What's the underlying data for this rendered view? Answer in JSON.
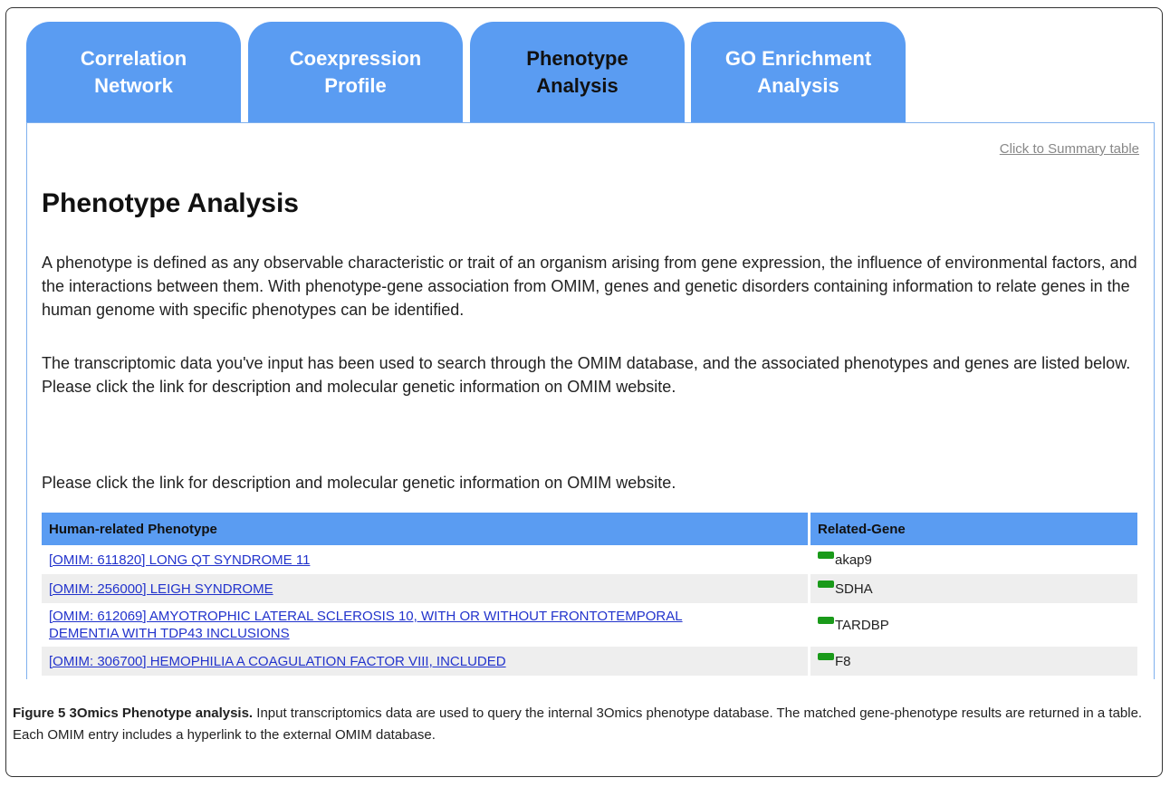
{
  "tabs": [
    {
      "label": "Correlation\nNetwork",
      "active": false
    },
    {
      "label": "Coexpression\nProfile",
      "active": false
    },
    {
      "label": "Phenotype\nAnalysis",
      "active": true
    },
    {
      "label": "GO Enrichment\nAnalysis",
      "active": false
    }
  ],
  "summary_link": "Click to Summary table",
  "page_title": "Phenotype Analysis",
  "paragraphs": [
    "A phenotype is defined as any observable characteristic or trait of an organism arising from gene expression, the influence of environmental factors, and the interactions between them. With phenotype-gene association from OMIM, genes and genetic disorders containing information to relate genes in the human genome with specific phenotypes can be identified.",
    "The transcriptomic data you've input has been used to search through the OMIM database, and the associated phenotypes and genes are listed below. Please click the link for description and molecular genetic information on OMIM website.",
    "Please click the link for description and molecular genetic information on OMIM website."
  ],
  "table": {
    "headers": [
      "Human-related Phenotype",
      "Related-Gene"
    ],
    "rows": [
      {
        "phenotype": "[OMIM: 611820] LONG QT SYNDROME 11",
        "gene": "akap9"
      },
      {
        "phenotype": "[OMIM: 256000] LEIGH SYNDROME",
        "gene": "SDHA"
      },
      {
        "phenotype": "[OMIM: 612069] AMYOTROPHIC LATERAL SCLEROSIS 10, WITH OR WITHOUT FRONTOTEMPORAL DEMENTIA WITH TDP43 INCLUSIONS",
        "gene": "TARDBP"
      },
      {
        "phenotype": "[OMIM: 306700] HEMOPHILIA A COAGULATION FACTOR VIII, INCLUDED",
        "gene": "F8"
      }
    ]
  },
  "gene_icon": "green-gene-marker-icon",
  "caption": {
    "label": "Figure 5 3Omics Phenotype analysis.",
    "text": " Input transcriptomics data are used to query the internal 3Omics phenotype database. The matched gene-phenotype results are returned in a table. Each OMIM entry includes a hyperlink to the external OMIM database."
  },
  "colors": {
    "tab_bg": "#5a9cf2",
    "header_bg": "#5a9cf2",
    "link": "#2233cc",
    "gene_icon": "#1a9a1a"
  }
}
